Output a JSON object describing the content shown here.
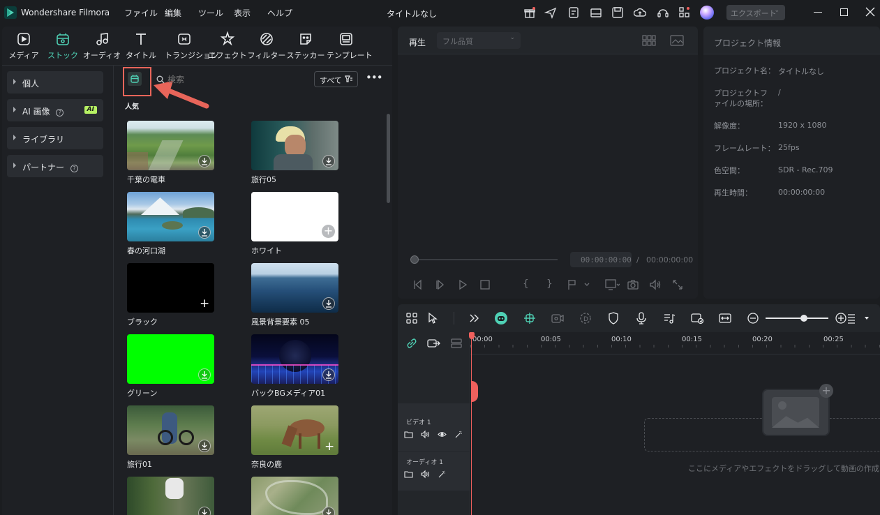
{
  "app": {
    "title": "Wondershare Filmora",
    "document_title": "タイトルなし",
    "export_label": "エクスポート"
  },
  "menu": [
    "ファイル",
    "編集",
    "ツール",
    "表示",
    "ヘルプ"
  ],
  "tabs": [
    {
      "label": "メディア",
      "icon": "media-icon"
    },
    {
      "label": "ストック",
      "icon": "stock-icon",
      "active": true
    },
    {
      "label": "オーディオ",
      "icon": "audio-icon"
    },
    {
      "label": "タイトル",
      "icon": "title-icon"
    },
    {
      "label": "トランジション",
      "icon": "transition-icon"
    },
    {
      "label": "エフェクト",
      "icon": "effect-icon"
    },
    {
      "label": "フィルター",
      "icon": "filter-icon"
    },
    {
      "label": "ステッカー",
      "icon": "sticker-icon"
    },
    {
      "label": "テンプレート",
      "icon": "template-icon"
    }
  ],
  "sidebar": {
    "items": [
      {
        "label": "個人"
      },
      {
        "label": "AI 画像",
        "badge": "AI"
      },
      {
        "label": "ライブラリ"
      },
      {
        "label": "パートナー"
      }
    ]
  },
  "browser": {
    "search_placeholder": "検索",
    "filter_label": "すべて",
    "section_title": "人気"
  },
  "stock": [
    {
      "label": "千葉の電車"
    },
    {
      "label": "旅行05"
    },
    {
      "label": "春の河口湖"
    },
    {
      "label": "ホワイト"
    },
    {
      "label": "ブラック"
    },
    {
      "label": "風景背景要素 05"
    },
    {
      "label": "グリーン"
    },
    {
      "label": "バックBGメディア01"
    },
    {
      "label": "旅行01"
    },
    {
      "label": "奈良の鹿"
    }
  ],
  "player": {
    "tab": "再生",
    "quality": "フル品質",
    "current_time": "00:00:00:00",
    "separator": "/",
    "total_time": "00:00:00:00"
  },
  "project_info": {
    "title": "プロジェクト情報",
    "rows": [
      {
        "label": "プロジェクト名：",
        "value": "タイトルなし"
      },
      {
        "label": "プロジェクトファイルの場所：",
        "value": "/"
      },
      {
        "label": "解像度：",
        "value": "1920 x 1080"
      },
      {
        "label": "フレームレート：",
        "value": "25fps"
      },
      {
        "label": "色空間：",
        "value": "SDR - Rec.709"
      },
      {
        "label": "再生時間：",
        "value": "00:00:00:00"
      }
    ]
  },
  "timeline": {
    "ruler": [
      "00:00",
      "00:05",
      "00:10",
      "00:15",
      "00:20",
      "00:25"
    ],
    "tracks": [
      {
        "label": "ビデオ 1"
      },
      {
        "label": "オーディオ 1"
      }
    ],
    "drop_hint": "ここにメディアやエフェクトをドラッグして動画の作成を開始しま"
  },
  "colors": {
    "accent": "#4fd1b5",
    "annotation": "#e8655a",
    "playhead": "#f0605d"
  }
}
